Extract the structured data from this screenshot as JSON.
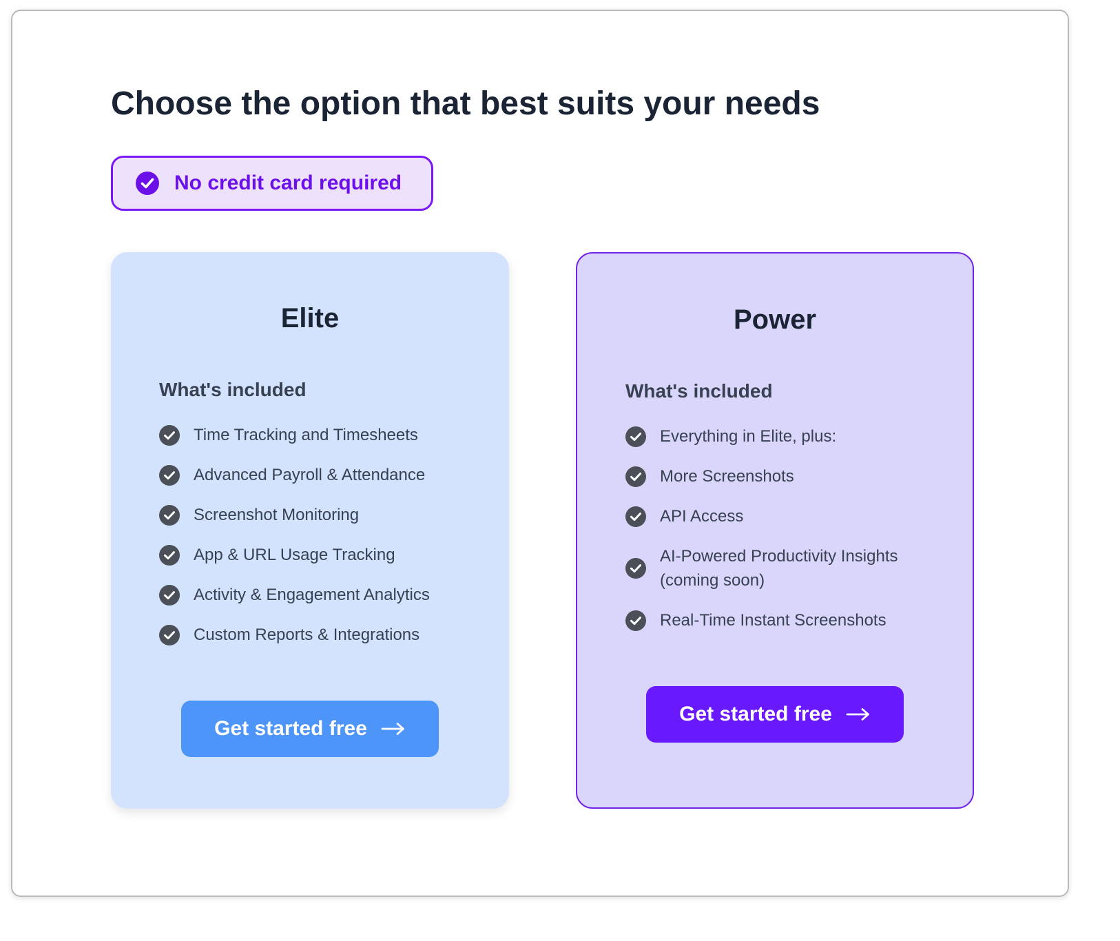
{
  "header": {
    "title": "Choose the option that best suits your needs"
  },
  "badge": {
    "label": "No credit card required",
    "icon": "check-circle-icon"
  },
  "plans": [
    {
      "name": "Elite",
      "subtitle": "What's included",
      "features": [
        "Time Tracking and Timesheets",
        "Advanced Payroll & Attendance",
        "Screenshot Monitoring",
        "App & URL Usage Tracking",
        "Activity & Engagement Analytics",
        "Custom Reports & Integrations"
      ],
      "cta_label": "Get started free"
    },
    {
      "name": "Power",
      "subtitle": "What's included",
      "features": [
        "Everything in Elite, plus:",
        "More Screenshots",
        "API Access",
        "AI-Powered Productivity Insights (coming soon)",
        "Real-Time Instant Screenshots"
      ],
      "cta_label": "Get started free"
    }
  ],
  "colors": {
    "brand_purple": "#6819fd",
    "badge_background": "#eee1fc",
    "elite_card_background": "#d4e3fd",
    "elite_button": "#4d95f8",
    "power_card_background": "#dad6fb",
    "check_icon": "#4b4f58"
  }
}
